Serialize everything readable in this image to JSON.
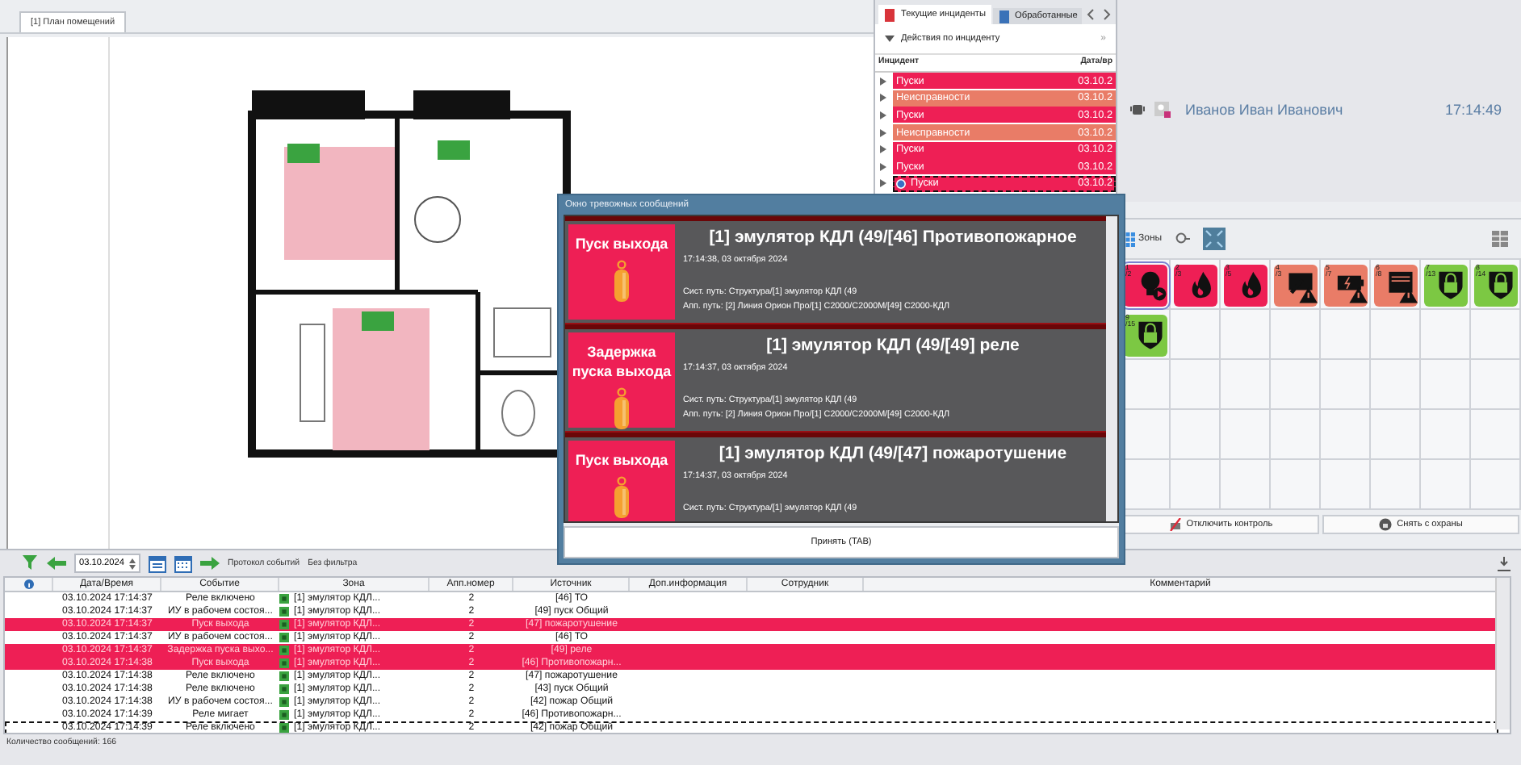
{
  "plan": {
    "tab": {
      "label": "[1] План помещений",
      "selected": true
    }
  },
  "incidents": {
    "tabs": [
      {
        "label": "Текущие инциденты",
        "selected": true,
        "kind": "current"
      },
      {
        "label": "Обработанные",
        "selected": false,
        "kind": "processed"
      }
    ],
    "actions": "Действия по инциденту",
    "more": "»",
    "columns": [
      "Инцидент",
      "Дата/вр"
    ],
    "rows": [
      {
        "label": "Пуски",
        "date": "03.10.2",
        "color": "#ee1f55",
        "selected": false
      },
      {
        "label": "Неисправности",
        "date": "03.10.2",
        "color": "#e97c67",
        "selected": false
      },
      {
        "label": "Пуски",
        "date": "03.10.2",
        "color": "#ee1f55",
        "selected": false
      },
      {
        "label": "Неисправности",
        "date": "03.10.2",
        "color": "#e97c67",
        "selected": false
      },
      {
        "label": "Пуски",
        "date": "03.10.2",
        "color": "#ee1f55",
        "selected": false
      },
      {
        "label": "Пуски",
        "date": "03.10.2",
        "color": "#ee1f55",
        "selected": false
      },
      {
        "label": "Пуски",
        "date": "03.10.2",
        "color": "#ee1f55",
        "selected": true
      }
    ]
  },
  "user": {
    "name": "Иванов Иван Иванович",
    "time": "17:14:49"
  },
  "zones": {
    "view_label": "Зоны",
    "fit_on": true,
    "tiles": [
      {
        "number": "1",
        "sub": "/2",
        "color": "#ee1f55",
        "kind": "output",
        "selected": true
      },
      {
        "number": "2",
        "sub": "/3",
        "color": "#ee1f55",
        "kind": "fire",
        "selected": false
      },
      {
        "number": "3",
        "sub": "/5",
        "color": "#ee1f55",
        "kind": "fire",
        "selected": false
      },
      {
        "number": "4",
        "sub": "/3",
        "color": "#e97c67",
        "kind": "service",
        "selected": false
      },
      {
        "number": "5",
        "sub": "/7",
        "color": "#e97c67",
        "kind": "power",
        "selected": false
      },
      {
        "number": "6",
        "sub": "/8",
        "color": "#e97c67",
        "kind": "fault",
        "selected": false
      },
      {
        "number": "7",
        "sub": "/13",
        "color": "#7cc843",
        "kind": "armed",
        "selected": false
      },
      {
        "number": "8",
        "sub": "/14",
        "color": "#7cc843",
        "kind": "armed",
        "selected": false
      },
      {
        "number": "9",
        "sub": "/15",
        "color": "#7cc843",
        "kind": "armed",
        "selected": false
      }
    ],
    "buttons": [
      {
        "label": "Отключить контроль",
        "kind": "disable"
      },
      {
        "label": "Снять с охраны",
        "kind": "disarm"
      }
    ]
  },
  "alarm_window": {
    "title": "Окно тревожных сообщений",
    "accept": "Принять (TAB)",
    "messages": [
      {
        "badge": "Пуск выхода",
        "title": "[1] эмулятор КДЛ (49/[46] Противопожарное",
        "time": "17:14:38, 03 октября 2024",
        "sys_path": "Сист. путь: Структура/[1] эмулятор КДЛ (49",
        "app_path": "Апп. путь: [2] Линия Орион Про/[1] С2000/С2000М/[49] С2000-КДЛ"
      },
      {
        "badge": "Задержка пуска выхода",
        "title": "[1] эмулятор КДЛ (49/[49] реле",
        "time": "17:14:37, 03 октября 2024",
        "sys_path": "Сист. путь: Структура/[1] эмулятор КДЛ (49",
        "app_path": "Апп. путь: [2] Линия Орион Про/[1] С2000/С2000М/[49] С2000-КДЛ"
      },
      {
        "badge": "Пуск выхода",
        "title": "[1] эмулятор КДЛ (49/[47] пожаротушение",
        "time": "17:14:37, 03 октября 2024",
        "sys_path": "Сист. путь: Структура/[1] эмулятор КДЛ (49"
      }
    ]
  },
  "events": {
    "date": "03.10.2024",
    "log_label": "Протокол событий",
    "filter_label": "Без фильтра",
    "columns": [
      "Дата/Время",
      "Событие",
      "Зона",
      "Апп.номер",
      "Источник",
      "Доп.информация",
      "Сотрудник",
      "Комментарий"
    ],
    "rows": [
      {
        "time": "03.10.2024 17:14:37",
        "event": "Реле включено",
        "zone": "[1] эмулятор КДЛ...",
        "number": "2",
        "source": "[46] ТО",
        "alarm": false,
        "selected": false
      },
      {
        "time": "03.10.2024 17:14:37",
        "event": "ИУ в рабочем состоя...",
        "zone": "[1] эмулятор КДЛ...",
        "number": "2",
        "source": "[49] пуск Общий",
        "alarm": false,
        "selected": false
      },
      {
        "time": "03.10.2024 17:14:37",
        "event": "Пуск выхода",
        "zone": "[1] эмулятор КДЛ...",
        "number": "2",
        "source": "[47] пожаротушение",
        "alarm": true,
        "selected": false
      },
      {
        "time": "03.10.2024 17:14:37",
        "event": "ИУ в рабочем состоя...",
        "zone": "[1] эмулятор КДЛ...",
        "number": "2",
        "source": "[46] ТО",
        "alarm": false,
        "selected": false
      },
      {
        "time": "03.10.2024 17:14:37",
        "event": "Задержка пуска выхо...",
        "zone": "[1] эмулятор КДЛ...",
        "number": "2",
        "source": "[49] реле",
        "alarm": true,
        "selected": false
      },
      {
        "time": "03.10.2024 17:14:38",
        "event": "Пуск выхода",
        "zone": "[1] эмулятор КДЛ...",
        "number": "2",
        "source": "[46] Противопожарн...",
        "alarm": true,
        "selected": false
      },
      {
        "time": "03.10.2024 17:14:38",
        "event": "Реле включено",
        "zone": "[1] эмулятор КДЛ...",
        "number": "2",
        "source": "[47] пожаротушение",
        "alarm": false,
        "selected": false
      },
      {
        "time": "03.10.2024 17:14:38",
        "event": "Реле включено",
        "zone": "[1] эмулятор КДЛ...",
        "number": "2",
        "source": "[43] пуск Общий",
        "alarm": false,
        "selected": false
      },
      {
        "time": "03.10.2024 17:14:38",
        "event": "ИУ в рабочем состоя...",
        "zone": "[1] эмулятор КДЛ...",
        "number": "2",
        "source": "[42] пожар Общий",
        "alarm": false,
        "selected": false
      },
      {
        "time": "03.10.2024 17:14:39",
        "event": "Реле мигает",
        "zone": "[1] эмулятор КДЛ...",
        "number": "2",
        "source": "[46] Противопожарн...",
        "alarm": false,
        "selected": false
      },
      {
        "time": "03.10.2024 17:14:39",
        "event": "Реле включено",
        "zone": "[1] эмулятор КДЛ...",
        "number": "2",
        "source": "[42] пожар Общий",
        "alarm": false,
        "selected": true
      }
    ],
    "status": "Количество сообщений: 166"
  }
}
